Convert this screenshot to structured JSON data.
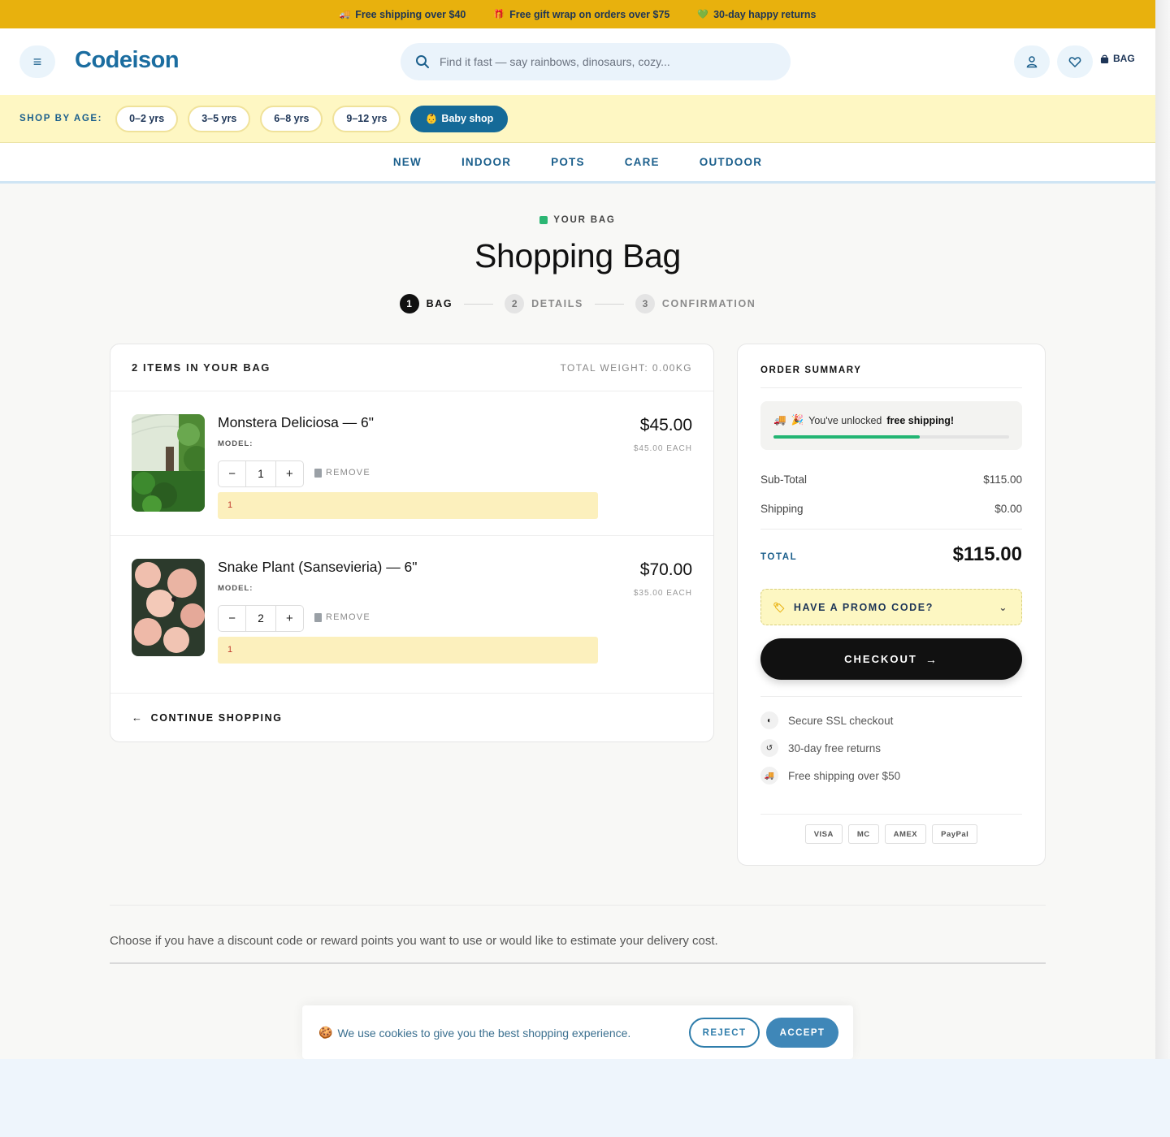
{
  "announcement": {
    "items": [
      {
        "icon": "truck-icon",
        "text": "Free shipping over $40"
      },
      {
        "icon": "gift-icon",
        "text": "Free gift wrap on orders over $75"
      },
      {
        "icon": "heart-icon",
        "text": "30-day happy returns"
      }
    ]
  },
  "header": {
    "logo": "Codeison",
    "search_placeholder": "Find it fast — say rainbows, dinosaurs, cozy...",
    "bag_label": "BAG"
  },
  "age_bar": {
    "label": "SHOP BY AGE:",
    "pills": [
      "0–2 yrs",
      "3–5 yrs",
      "6–8 yrs",
      "9–12 yrs"
    ],
    "baby_shop": "Baby shop"
  },
  "nav": {
    "items": [
      "NEW",
      "INDOOR",
      "POTS",
      "CARE",
      "OUTDOOR"
    ]
  },
  "page": {
    "eyebrow": "YOUR BAG",
    "title": "Shopping Bag",
    "steps": [
      {
        "num": "1",
        "label": "BAG"
      },
      {
        "num": "2",
        "label": "DETAILS"
      },
      {
        "num": "3",
        "label": "CONFIRMATION"
      }
    ]
  },
  "cart": {
    "count_label": "2 ITEMS IN YOUR BAG",
    "weight_label": "TOTAL WEIGHT: 0.00KG",
    "items": [
      {
        "name": "Monstera Deliciosa — 6\"",
        "model_label": "MODEL:",
        "qty": "1",
        "remove_label": "REMOVE",
        "note": "1",
        "price": "$45.00",
        "each": "$45.00 EACH"
      },
      {
        "name": "Snake Plant (Sansevieria) — 6\"",
        "model_label": "MODEL:",
        "qty": "2",
        "remove_label": "REMOVE",
        "note": "1",
        "price": "$70.00",
        "each": "$35.00 EACH"
      }
    ],
    "continue_label": "CONTINUE SHOPPING"
  },
  "summary": {
    "title": "ORDER SUMMARY",
    "shipping_msg_prefix": "You've unlocked",
    "shipping_msg_bold": "free shipping!",
    "progress": 0.62,
    "subtotal_label": "Sub-Total",
    "subtotal_value": "$115.00",
    "shipping_label": "Shipping",
    "shipping_value": "$0.00",
    "total_label": "TOTAL",
    "total_value": "$115.00",
    "promo_label": "HAVE A PROMO CODE?",
    "checkout_label": "CHECKOUT",
    "trust": [
      {
        "icon": "shield-icon",
        "text": "Secure SSL checkout"
      },
      {
        "icon": "returns-icon",
        "text": "30-day free returns"
      },
      {
        "icon": "truck-icon",
        "text": "Free shipping over $50"
      }
    ],
    "payment_methods": [
      "VISA",
      "MC",
      "AMEX",
      "PayPal"
    ]
  },
  "lower": {
    "text": "Choose if you have a discount code or reward points you want to use or would like to estimate your delivery cost."
  },
  "cookie": {
    "text": "We use cookies to give you the best shopping experience.",
    "reject": "REJECT",
    "accept": "ACCEPT"
  },
  "colors": {
    "announce_bg": "#e8b10d",
    "brand_blue": "#1b6da0",
    "age_bar_bg": "#fef7c3",
    "success_green": "#22b573",
    "checkout_black": "#111111"
  }
}
